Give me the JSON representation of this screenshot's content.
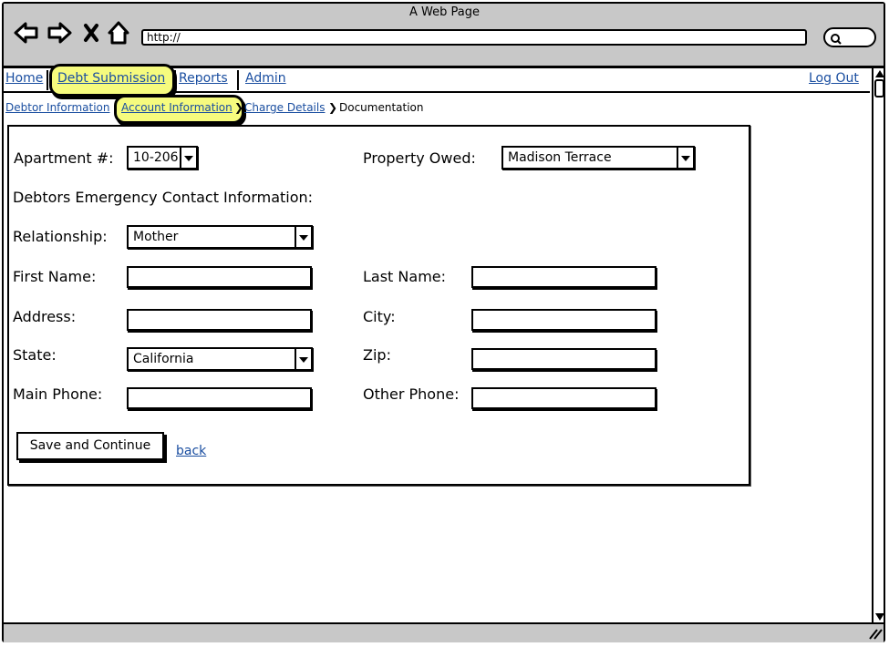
{
  "browser": {
    "title": "A Web Page",
    "url": "http://"
  },
  "nav": {
    "home": "Home",
    "debt_submission": "Debt Submission",
    "reports": "Reports",
    "admin": "Admin",
    "logout": "Log Out"
  },
  "breadcrumb": {
    "debtor_info": "Debtor Information",
    "account_info": "Account Information",
    "charge_details": "Charge Details",
    "documentation": "Documentation"
  },
  "form": {
    "apartment_label": "Apartment #:",
    "apartment_value": "10-206",
    "property_label": "Property Owed:",
    "property_value": "Madison Terrace",
    "section_heading": "Debtors Emergency Contact Information:",
    "relationship_label": "Relationship:",
    "relationship_value": "Mother",
    "first_name_label": "First Name:",
    "last_name_label": "Last Name:",
    "address_label": "Address:",
    "city_label": "City:",
    "state_label": "State:",
    "state_value": "California",
    "zip_label": "Zip:",
    "main_phone_label": "Main Phone:",
    "other_phone_label": "Other Phone:",
    "save_button": "Save and Continue",
    "back_link": "back"
  },
  "colors": {
    "highlight": "#f6fb7e",
    "link": "#1a4ea0",
    "chrome": "#c8c8c8"
  }
}
